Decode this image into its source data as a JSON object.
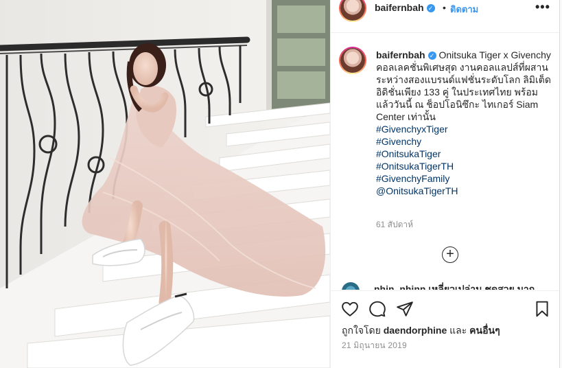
{
  "post": {
    "username": "baifernbah",
    "verified_mark": "✓",
    "follow_label": "ติดตาม",
    "dot": "•",
    "more_label": "•••",
    "caption_user": "baifernbah",
    "caption_text": "Onitsuka Tiger x Givenchy\nคอลเลคชั่นพิเศษสุด งานคอลแลปส์ที่ผสานระหว่างสองแบรนด์แฟชั่นระดับโลก ลิมิเต็ดอิดิชั่นเพียง 133 คู่ ในประเทศไทย พร้อมแล้ววันนี้ ณ ช็อปโอนิซึกะ ไทเกอร์ Siam Center เท่านั้น",
    "hashtags": [
      "#GivenchyxTiger",
      "#Givenchy",
      "#OnitsukaTiger",
      "#OnitsukaTigerTH",
      "#GivenchyFamily",
      "@OnitsukaTigerTH"
    ],
    "time_ago": "61 สัปดาห์",
    "load_more_symbol": "+",
    "cut_comment": "nhin_nhinn เหลี่ยวเปล่าน ชุดสวย มาก",
    "likes_prefix": "ถูกใจโดย",
    "likes_user": "daendorphine",
    "likes_and": "และ",
    "likes_others": "คนอื่นๆ",
    "date": "21 มิถุนายน 2019"
  },
  "icons": {
    "like": "heart-outline-icon",
    "comment": "speech-bubble-icon",
    "share": "paper-plane-icon",
    "save": "bookmark-icon",
    "more": "more-options-icon",
    "verified": "verified-badge-icon",
    "load_more": "plus-circle-icon"
  },
  "colors": {
    "link_blue": "#3897f0",
    "hashtag": "#003569",
    "muted": "#8e8e8e",
    "text": "#262626"
  }
}
